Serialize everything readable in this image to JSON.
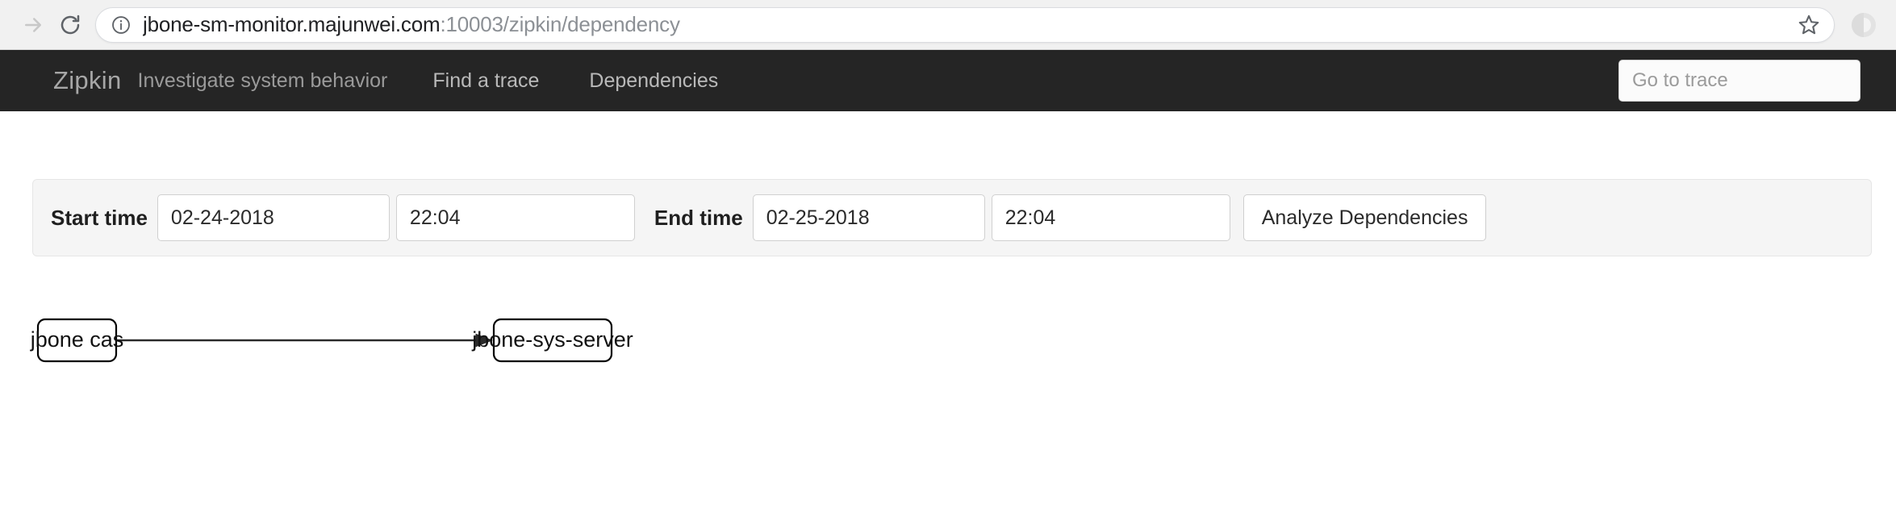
{
  "browser": {
    "forward_icon": "arrow-forward-icon",
    "reload_icon": "reload-icon",
    "site_info_icon": "info-circle-icon",
    "bookmark_icon": "star-outline-icon",
    "profile_icon": "profile-avatar-icon",
    "url_full": "jbone-sm-monitor.majunwei.com:10003/zipkin/dependency",
    "url_host": "jbone-sm-monitor.majunwei.com",
    "url_rest": ":10003/zipkin/dependency"
  },
  "app_nav": {
    "brand": "Zipkin",
    "tagline": "Investigate system behavior",
    "links": [
      {
        "label": "Find a trace"
      },
      {
        "label": "Dependencies"
      }
    ],
    "trace_search_placeholder": "Go to trace",
    "background_color": "#252525",
    "text_color": "#b9b9b9"
  },
  "query_panel": {
    "start_label": "Start time",
    "start_date": "02-24-2018",
    "start_time": "22:04",
    "end_label": "End time",
    "end_date": "02-25-2018",
    "end_time": "22:04",
    "analyze_button": "Analyze Dependencies",
    "background_color": "#f5f5f5"
  },
  "dependency_graph": {
    "nodes": [
      {
        "id": "jbone-cas",
        "label": "jbone cas"
      },
      {
        "id": "jbone-sys-server",
        "label": "jbone-sys-server"
      }
    ],
    "edges": [
      {
        "from": "jbone-cas",
        "to": "jbone-sys-server"
      }
    ]
  }
}
